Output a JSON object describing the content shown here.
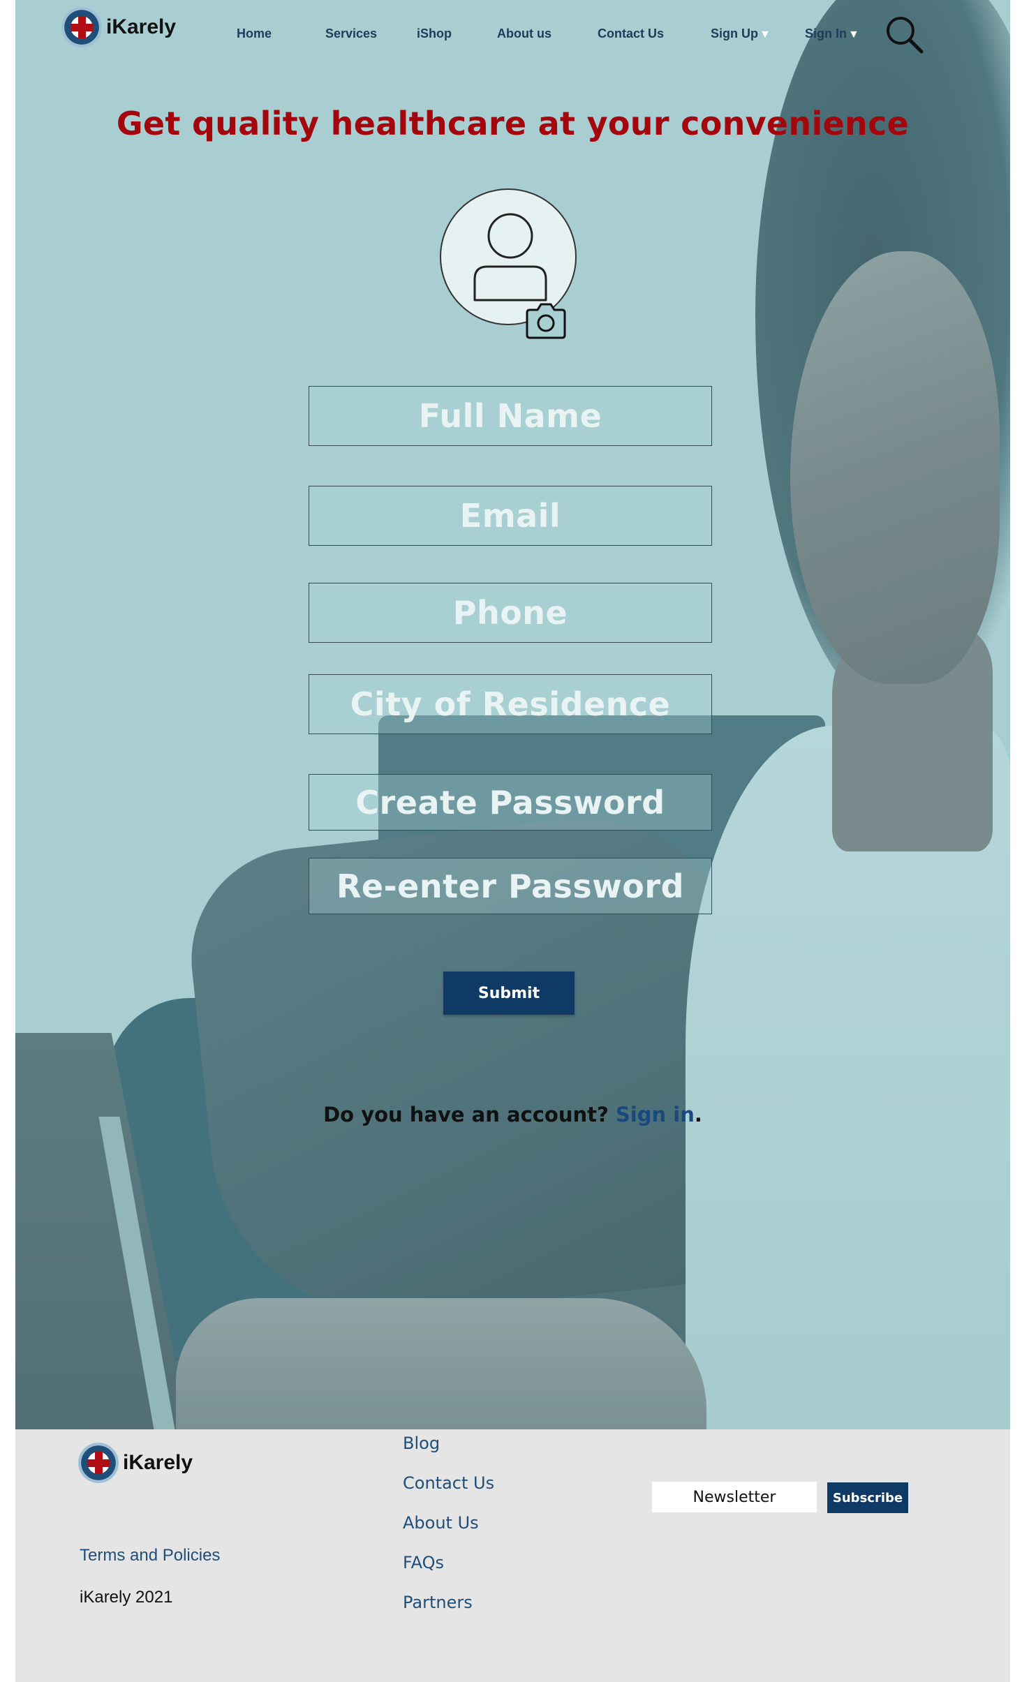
{
  "brand": {
    "name": "iKarely"
  },
  "nav": {
    "items": [
      {
        "label": "Home"
      },
      {
        "label": "Services"
      },
      {
        "label": "iShop"
      },
      {
        "label": "About us"
      },
      {
        "label": "Contact Us"
      },
      {
        "label": "Sign Up",
        "caret": "▼"
      },
      {
        "label": "Sign In",
        "caret": "▼"
      }
    ]
  },
  "hero": {
    "headline": "Get quality healthcare at your convenience"
  },
  "form": {
    "fields": [
      {
        "placeholder": "Full Name"
      },
      {
        "placeholder": "Email"
      },
      {
        "placeholder": "Phone"
      },
      {
        "placeholder": "City of Residence"
      },
      {
        "placeholder": "Create Password"
      },
      {
        "placeholder": "Re-enter Password"
      }
    ],
    "submit_label": "Submit",
    "account_prompt": "Do you have an account? ",
    "signin_link": "Sign in",
    "period": "."
  },
  "footer": {
    "links": [
      "Blog",
      "Contact Us",
      "About Us",
      "FAQs",
      "Partners"
    ],
    "terms": "Terms and Policies",
    "copyright": "iKarely 2021",
    "newsletter_placeholder": "Newsletter",
    "subscribe_label": "Subscribe"
  },
  "colors": {
    "headline": "#a3060d",
    "primary_button": "#0f3a66",
    "nav_text": "#1f3b57",
    "hero_tint": "#a9cfd2",
    "footer_bg": "#e5e5e5"
  },
  "icons": [
    "logo-mark-icon",
    "search-icon",
    "user-avatar-icon",
    "camera-icon"
  ]
}
